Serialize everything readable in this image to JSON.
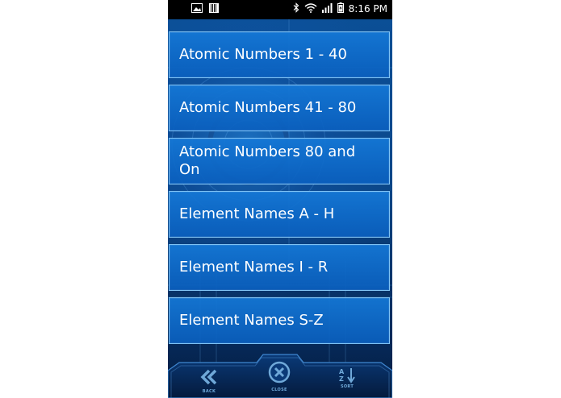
{
  "status_bar": {
    "time": "8:16 PM"
  },
  "menu": {
    "items": [
      {
        "label": "Atomic Numbers 1 - 40"
      },
      {
        "label": "Atomic Numbers 41 - 80"
      },
      {
        "label": "Atomic Numbers 80 and On"
      },
      {
        "label": "Element Names A - H"
      },
      {
        "label": "Element Names I - R"
      },
      {
        "label": "Element Names S-Z"
      }
    ]
  },
  "bottom_nav": {
    "back_label": "BACK",
    "close_label": "CLOSE",
    "sort_label": "SORT",
    "sort_glyph": "A Z"
  },
  "colors": {
    "accent": "#1577d2",
    "border": "#7fc3f5",
    "status_bar": "#000000"
  }
}
